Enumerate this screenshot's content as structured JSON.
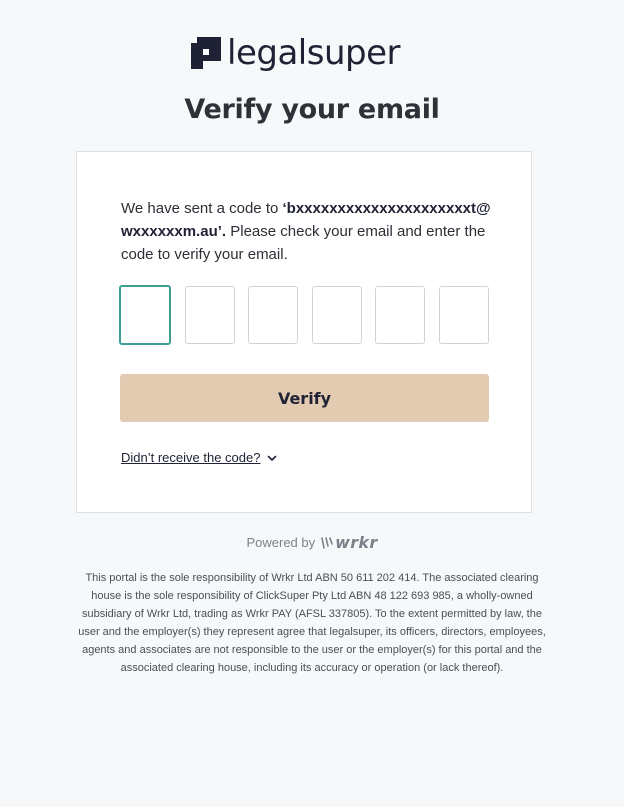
{
  "brand": {
    "name": "legalsuper"
  },
  "heading": "Verify your email",
  "message": {
    "prefix": "We have sent a code to ",
    "email": "‘bxxxxxxxxxxxxxxxxxxxxxt@wxxxxxxm.au’.",
    "suffix": " Please check your email and enter the code to verify your email."
  },
  "code": {
    "digits": [
      "",
      "",
      "",
      "",
      "",
      ""
    ],
    "active_index": 0
  },
  "verify_label": "Verify",
  "resend_label": "Didn’t receive the code?",
  "powered": {
    "label": "Powered by",
    "provider": "wrkr"
  },
  "disclaimer": "This portal is the sole responsibility of Wrkr Ltd ABN 50 611 202 414. The associated clearing house is the sole responsibility of ClickSuper Pty Ltd ABN 48 122 693 985, a wholly-owned subsidiary of Wrkr Ltd, trading as Wrkr PAY (AFSL 337805). To the extent permitted by law, the user and the employer(s) they represent agree that legalsuper, its officers, directors, employees, agents and associates are not responsible to the user or the employer(s) for this portal and the associated clearing house, including its accuracy or operation (or lack thereof).",
  "colors": {
    "accent_button": "#e2cbb1",
    "focus_border": "#3f9e94",
    "brand_dark": "#1f2235"
  }
}
